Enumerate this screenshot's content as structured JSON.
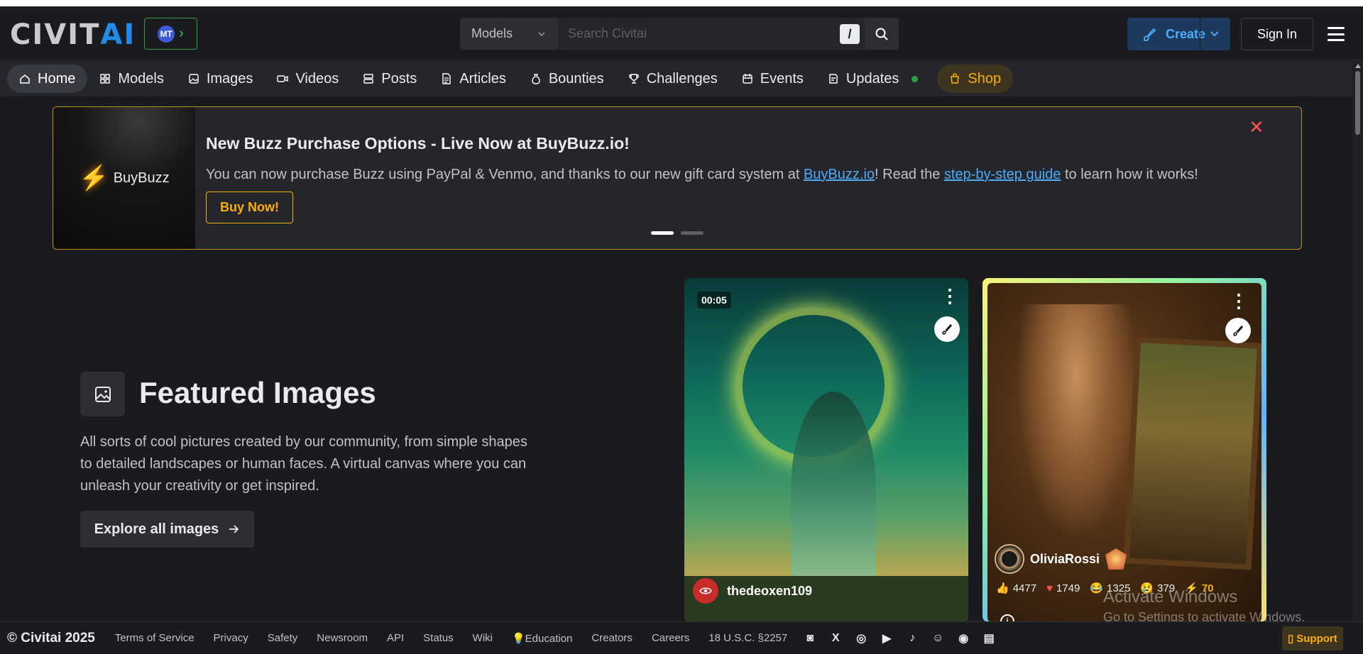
{
  "header": {
    "logo_left": "CIVIT",
    "logo_right": "AI",
    "logo_badge": "MT",
    "search": {
      "type_label": "Models",
      "placeholder": "Search Civitai",
      "shortcut": "/"
    },
    "create_label": "Create",
    "signin_label": "Sign In"
  },
  "nav": {
    "items": [
      {
        "label": "Home",
        "icon": "home-icon"
      },
      {
        "label": "Models",
        "icon": "grid-icon"
      },
      {
        "label": "Images",
        "icon": "photo-icon"
      },
      {
        "label": "Videos",
        "icon": "video-icon"
      },
      {
        "label": "Posts",
        "icon": "posts-icon"
      },
      {
        "label": "Articles",
        "icon": "article-icon"
      },
      {
        "label": "Bounties",
        "icon": "moneybag-icon"
      },
      {
        "label": "Challenges",
        "icon": "trophy-icon"
      },
      {
        "label": "Events",
        "icon": "calendar-icon"
      },
      {
        "label": "Updates",
        "icon": "updates-icon"
      },
      {
        "label": "Shop",
        "icon": "shopping-bag-icon"
      }
    ]
  },
  "banner": {
    "image_text": "BuyBuzz",
    "title": "New Buzz Purchase Options - Live Now at BuyBuzz.io!",
    "text_part1": "You can now purchase Buzz using PayPal & Venmo, and thanks to our new gift card system at ",
    "link1": "BuyBuzz.io",
    "text_part2": "! Read the ",
    "link2": "step-by-step guide",
    "text_part3": " to learn how it works!",
    "button_label": "Buy Now!"
  },
  "featured": {
    "title": "Featured Images",
    "description": "All sorts of cool pictures created by our community, from simple shapes to detailed landscapes or human faces. A virtual canvas where you can unleash your creativity or get inspired.",
    "button_label": "Explore all images"
  },
  "cards": [
    {
      "duration": "00:05",
      "username": "thedeoxen109"
    },
    {
      "username": "OliviaRossi",
      "likes": "4477",
      "hearts": "1749",
      "laughs": "1325",
      "cries": "379",
      "buzz": "70"
    }
  ],
  "watermark": {
    "line1": "Activate Windows",
    "line2": "Go to Settings to activate Windows."
  },
  "footer": {
    "copyright": "© Civitai 2025",
    "links": [
      "Terms of Service",
      "Privacy",
      "Safety",
      "Newsroom",
      "API",
      "Status",
      "Wiki",
      "💡Education",
      "Creators",
      "Careers",
      "18 U.S.C. §2257"
    ],
    "support_label": "Support"
  },
  "colors": {
    "brand_blue": "#228be6",
    "accent_gold": "#fab005",
    "bg": "#1a1b1e",
    "nav_bg": "#25262b"
  }
}
